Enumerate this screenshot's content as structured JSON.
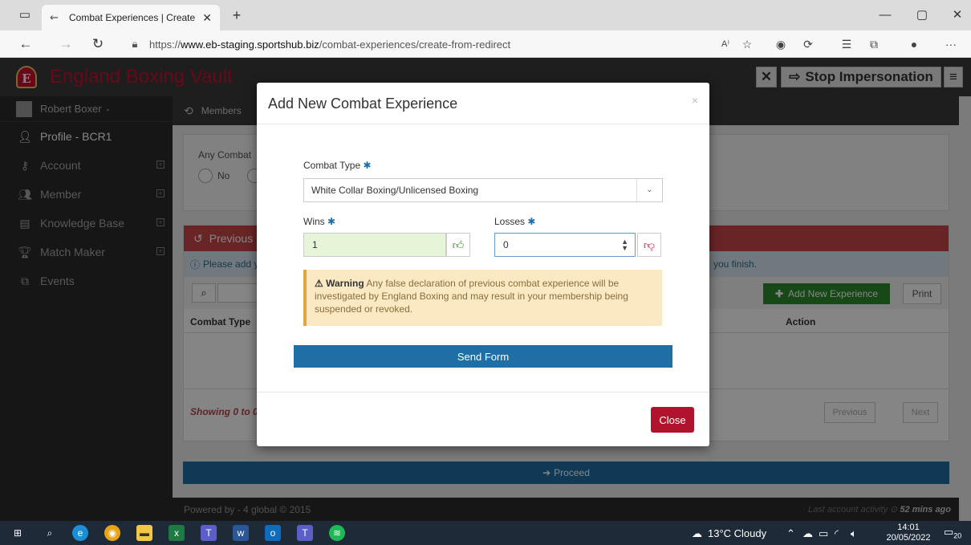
{
  "browser": {
    "tab_title": "Combat Experiences | Create",
    "url_prefix": "https://",
    "url_domain": "www.eb-staging.sportshub.biz",
    "url_path": "/combat-experiences/create-from-redirect"
  },
  "app": {
    "brand": "England Boxing Vault",
    "logo_letter": "E",
    "stop_impersonation": "Stop Impersonation"
  },
  "sidebar": {
    "user": "Robert Boxer",
    "items": [
      {
        "label": "Profile - BCR1"
      },
      {
        "label": "Account"
      },
      {
        "label": "Member"
      },
      {
        "label": "Knowledge Base"
      },
      {
        "label": "Match Maker"
      },
      {
        "label": "Events"
      }
    ]
  },
  "main": {
    "breadcrumb": "Members",
    "question_partial": "Any Combat",
    "radio_no": "No",
    "panel_title_partial": "Previous C",
    "info_partial": "Please add y",
    "info_tail": "you finish.",
    "add_button": "Add New Experience",
    "print_button": "Print",
    "col_combat_type": "Combat Type",
    "col_action": "Action",
    "showing_partial": "Showing 0 to 0",
    "previous": "Previous",
    "next": "Next",
    "proceed": "Proceed",
    "footer": "Powered by - 4 global © 2015",
    "last_activity_label": "Last account activity",
    "last_activity_value": "52 mins ago"
  },
  "modal": {
    "title": "Add New Combat Experience",
    "combat_type_label": "Combat Type",
    "combat_type_value": "White Collar Boxing/Unlicensed Boxing",
    "wins_label": "Wins",
    "wins_value": "1",
    "losses_label": "Losses",
    "losses_value": "0",
    "warning_title": "Warning",
    "warning_text": "Any false declaration of previous combat experience will be investigated by England Boxing and may result in your membership being suspended or revoked.",
    "send_button": "Send Form",
    "close_button": "Close"
  },
  "taskbar": {
    "weather": "13°C  Cloudy",
    "time": "14:01",
    "date": "20/05/2022",
    "notifications": "20"
  },
  "colors": {
    "brand_red": "#c8102e",
    "primary_blue": "#1f6ea6",
    "success_green": "#2f8a2f",
    "close_red": "#b0142c"
  }
}
